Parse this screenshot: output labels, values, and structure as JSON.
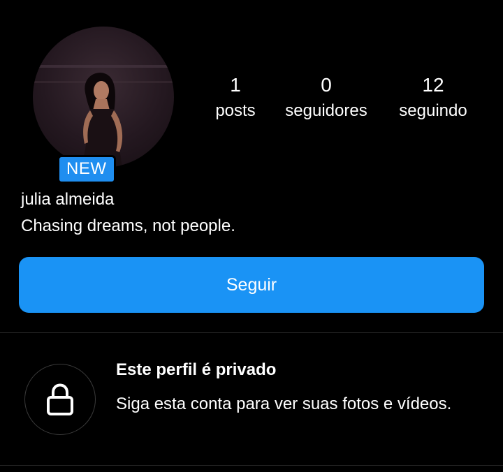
{
  "profile": {
    "badge": "NEW",
    "name": "julia almeida",
    "bio": "Chasing dreams, not people."
  },
  "stats": {
    "posts": {
      "value": "1",
      "label": "posts"
    },
    "followers": {
      "value": "0",
      "label": "seguidores"
    },
    "following": {
      "value": "12",
      "label": "seguindo"
    }
  },
  "actions": {
    "follow_label": "Seguir"
  },
  "private_notice": {
    "title": "Este perfil é privado",
    "text": "Siga esta conta para ver suas fotos e vídeos.",
    "icon": "lock-icon"
  },
  "colors": {
    "background": "#000000",
    "accent": "#1a93f5",
    "badge": "#1f8ef0",
    "divider": "#262626"
  }
}
